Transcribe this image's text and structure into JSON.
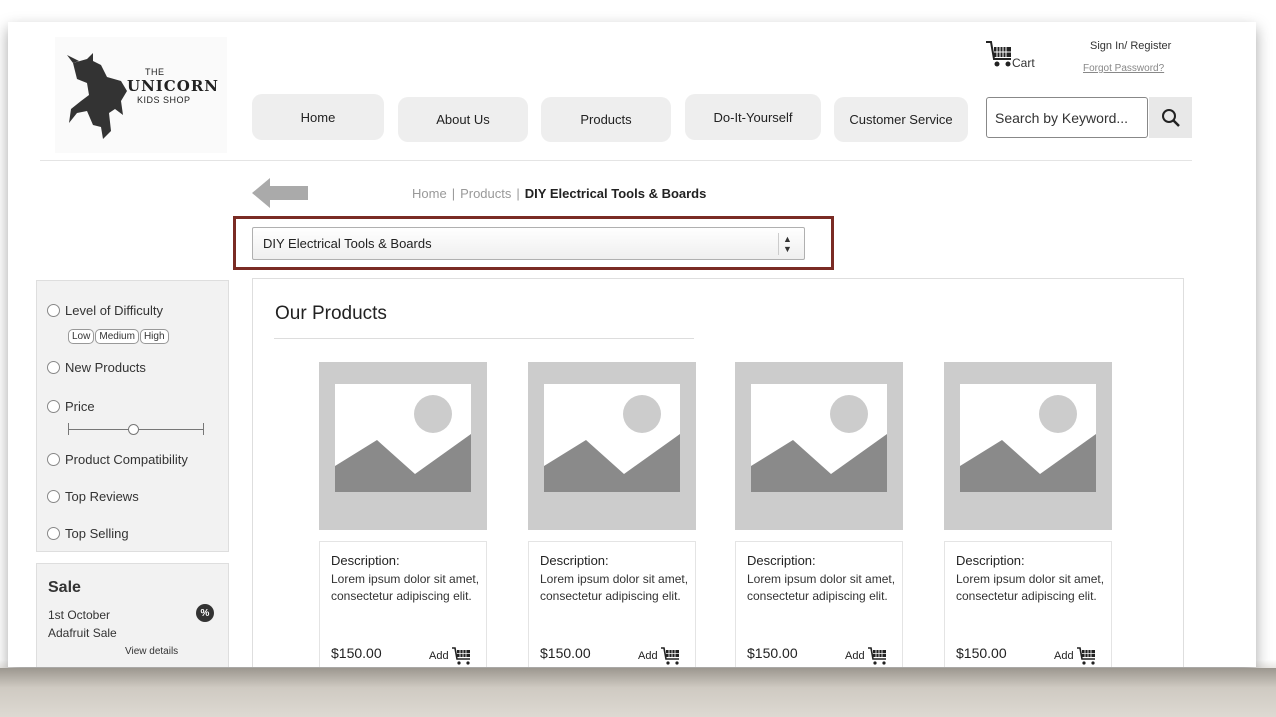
{
  "logo": {
    "line1": "THE",
    "line2": "UNICORN",
    "line3": "KIDS SHOP"
  },
  "nav": [
    "Home",
    "About Us",
    "Products",
    "Do-It-Yourself",
    "Customer Service"
  ],
  "header": {
    "cart_label": "Cart",
    "signin_label": "Sign In/ Register",
    "forgot_label": "Forgot Password?",
    "search_placeholder": "Search by Keyword..."
  },
  "breadcrumb": {
    "home": "Home",
    "products": "Products",
    "current": "DIY Electrical Tools & Boards",
    "separator": "|"
  },
  "category_select": {
    "value": "DIY Electrical Tools & Boards"
  },
  "filters": {
    "difficulty": "Level of Difficulty",
    "difficulty_levels": [
      "Low",
      "Medium",
      "High"
    ],
    "new_products": "New Products",
    "price": "Price",
    "compatibility": "Product Compatibility",
    "top_reviews": "Top Reviews",
    "top_selling": "Top Selling"
  },
  "sale": {
    "title": "Sale",
    "date": "1st October",
    "name": "Adafruit Sale",
    "link": "View details",
    "badge": "%"
  },
  "main": {
    "title": "Our Products",
    "products": [
      {
        "desc_title": "Description:",
        "desc": "Lorem ipsum dolor sit amet, consectetur adipiscing elit.",
        "price": "$150.00",
        "add": "Add"
      },
      {
        "desc_title": "Description:",
        "desc": "Lorem ipsum dolor sit amet, consectetur adipiscing elit.",
        "price": "$150.00",
        "add": "Add"
      },
      {
        "desc_title": "Description:",
        "desc": "Lorem ipsum dolor sit amet, consectetur adipiscing elit.",
        "price": "$150.00",
        "add": "Add"
      },
      {
        "desc_title": "Description:",
        "desc": "Lorem ipsum dolor sit amet, consectetur adipiscing elit.",
        "price": "$150.00",
        "add": "Add"
      }
    ]
  },
  "colors": {
    "highlight_border": "#7a2b24",
    "placeholder_gray": "#cccccc",
    "panel_bg": "#f2f2f2"
  }
}
